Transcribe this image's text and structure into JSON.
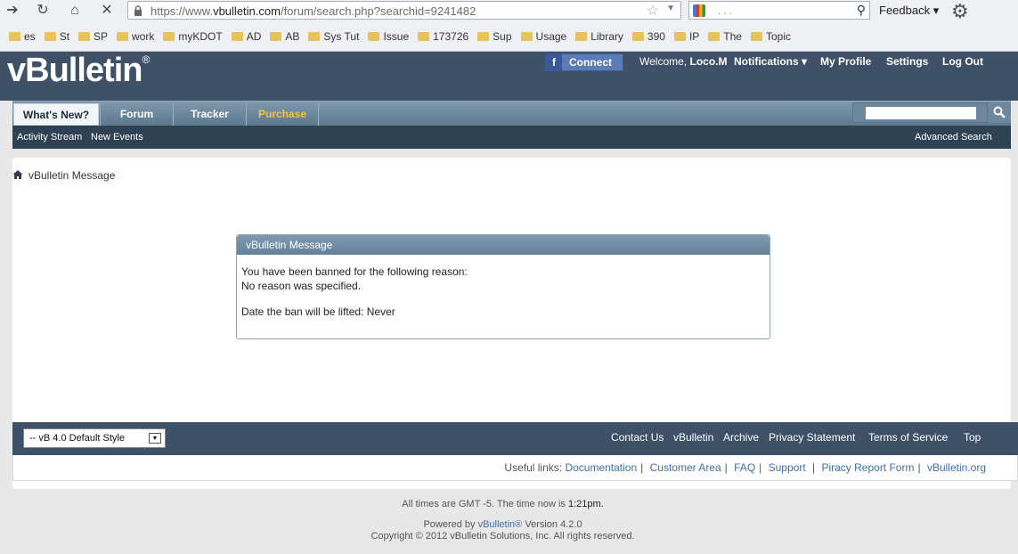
{
  "browser": {
    "url_prefix": "https://www.",
    "url_host": "vbulletin.com",
    "url_path": "/forum/search.php?searchid=9241482",
    "search_query": "...",
    "feedback_label": "Feedback",
    "bookmarks": [
      "es",
      "St",
      "SP",
      "work",
      "myKDOT",
      "AD",
      "AB",
      "Sys Tut",
      "Issue",
      "173726",
      "Sup",
      "Usage",
      "Library",
      "390",
      "IP",
      "The",
      "Topic"
    ]
  },
  "header": {
    "logo_text": "vBulletin",
    "logo_mark": "®",
    "fb_connect": "Connect",
    "welcome_label": "Welcome,",
    "username": "Loco.M",
    "notifications": "Notifications",
    "my_profile": "My Profile",
    "settings": "Settings",
    "logout": "Log Out"
  },
  "nav": {
    "tabs": [
      "What's New?",
      "Forum",
      "Tracker",
      "Purchase"
    ],
    "sub": [
      "Activity Stream",
      "New Events"
    ],
    "advanced_search": "Advanced Search"
  },
  "breadcrumb": "vBulletin Message",
  "message": {
    "title": "vBulletin Message",
    "line1": "You have been banned for the following reason:",
    "line2": "No reason was specified.",
    "line3": "Date the ban will be lifted: Never"
  },
  "footer": {
    "style_select": "-- vB 4.0 Default Style",
    "links": [
      "Contact Us",
      "vBulletin",
      "Archive",
      "Privacy Statement",
      "Terms of Service",
      "Top"
    ],
    "useful_label": "Useful links:",
    "useful_links": [
      "Documentation",
      "Customer Area",
      "FAQ",
      "Support",
      "Piracy Report Form",
      "vBulletin.org"
    ],
    "times_text": "All times are GMT -5. The time now is",
    "time_now": "1:21pm.",
    "powered_by": "Powered by",
    "powered_link": "vBulletin®",
    "version": "Version 4.2.0",
    "copyright": "Copyright © 2012 vBulletin Solutions, Inc. All rights reserved."
  }
}
